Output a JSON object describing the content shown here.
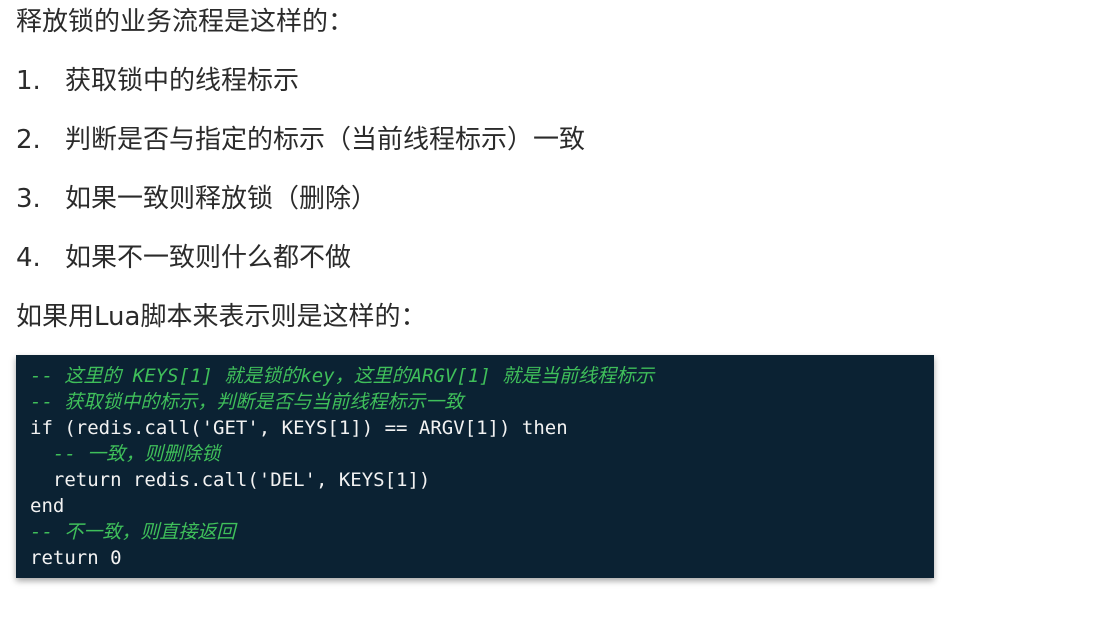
{
  "intro": "释放锁的业务流程是这样的：",
  "steps": [
    {
      "num": "1.",
      "text": "获取锁中的线程标示"
    },
    {
      "num": "2.",
      "text": "判断是否与指定的标示（当前线程标示）一致"
    },
    {
      "num": "3.",
      "text": "如果一致则释放锁（删除）"
    },
    {
      "num": "4.",
      "text": "如果不一致则什么都不做"
    }
  ],
  "lua_intro": "如果用Lua脚本来表示则是这样的：",
  "code": {
    "lines": [
      {
        "text": "-- 这里的 KEYS[1] 就是锁的key，这里的ARGV[1] 就是当前线程标示",
        "type": "comment"
      },
      {
        "text": "-- 获取锁中的标示，判断是否与当前线程标示一致",
        "type": "comment"
      },
      {
        "text": "if (redis.call('GET', KEYS[1]) == ARGV[1]) then",
        "type": "code"
      },
      {
        "text": "  -- 一致，则删除锁",
        "type": "comment"
      },
      {
        "text": "  return redis.call('DEL', KEYS[1])",
        "type": "code"
      },
      {
        "text": "end",
        "type": "code"
      },
      {
        "text": "-- 不一致，则直接返回",
        "type": "comment"
      },
      {
        "text": "return 0",
        "type": "code"
      }
    ]
  },
  "colors": {
    "code_background": "#0b2233",
    "comment": "#3fbf5a",
    "code_text": "#f2f2f2"
  }
}
